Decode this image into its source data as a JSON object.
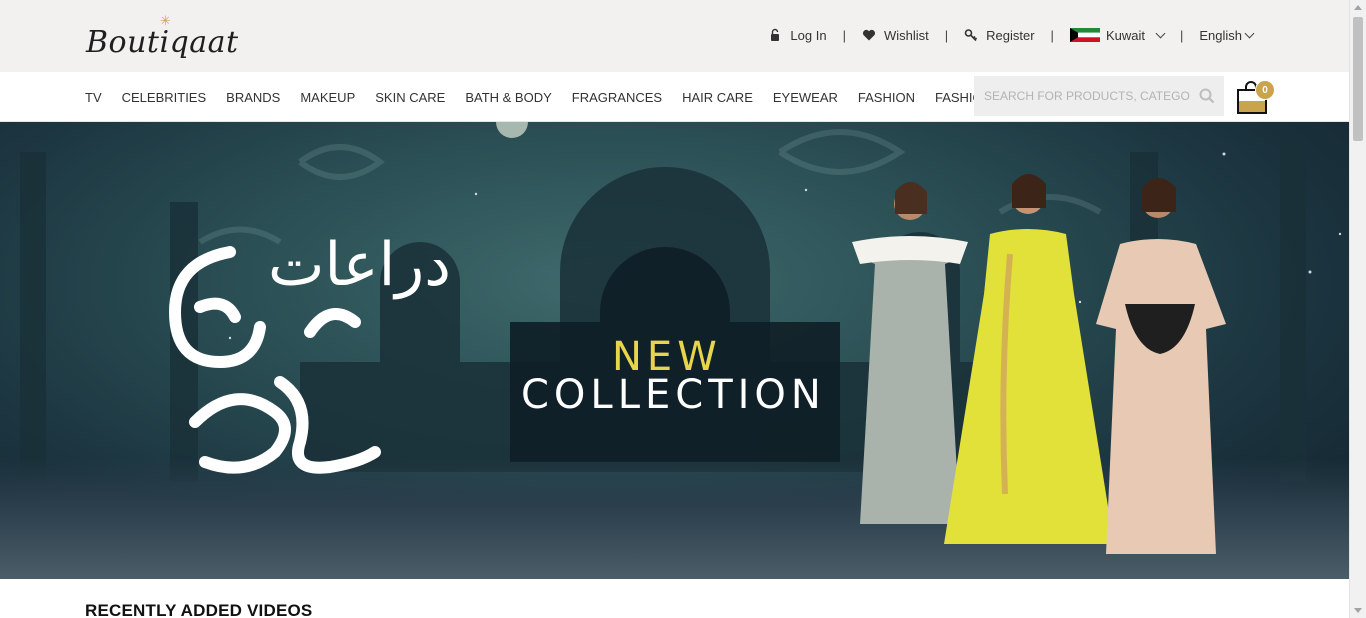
{
  "brand": {
    "logo_text": "Boutiqaat",
    "accent_color": "#c9a44c"
  },
  "top_bar": {
    "login_label": "Log In",
    "wishlist_label": "Wishlist",
    "register_label": "Register",
    "country_label": "Kuwait",
    "language_label": "English",
    "separator": "|"
  },
  "nav": {
    "items": [
      "TV",
      "CELEBRITIES",
      "BRANDS",
      "MAKEUP",
      "SKIN CARE",
      "BATH & BODY",
      "FRAGRANCES",
      "HAIR CARE",
      "EYEWEAR",
      "FASHION",
      "FASHION TECH"
    ]
  },
  "search": {
    "placeholder": "SEARCH FOR PRODUCTS, CATEGORIES"
  },
  "cart": {
    "count": "0"
  },
  "hero": {
    "arabic_text": "دراعات",
    "headline_1": "NEW",
    "headline_2": "COLLECTION"
  },
  "section": {
    "title": "RECENTLY ADDED VIDEOS"
  },
  "icons": [
    "lock-icon",
    "heart-icon",
    "key-icon",
    "kuwait-flag-icon",
    "chevron-down-icon",
    "search-icon",
    "shopping-bag-icon"
  ]
}
